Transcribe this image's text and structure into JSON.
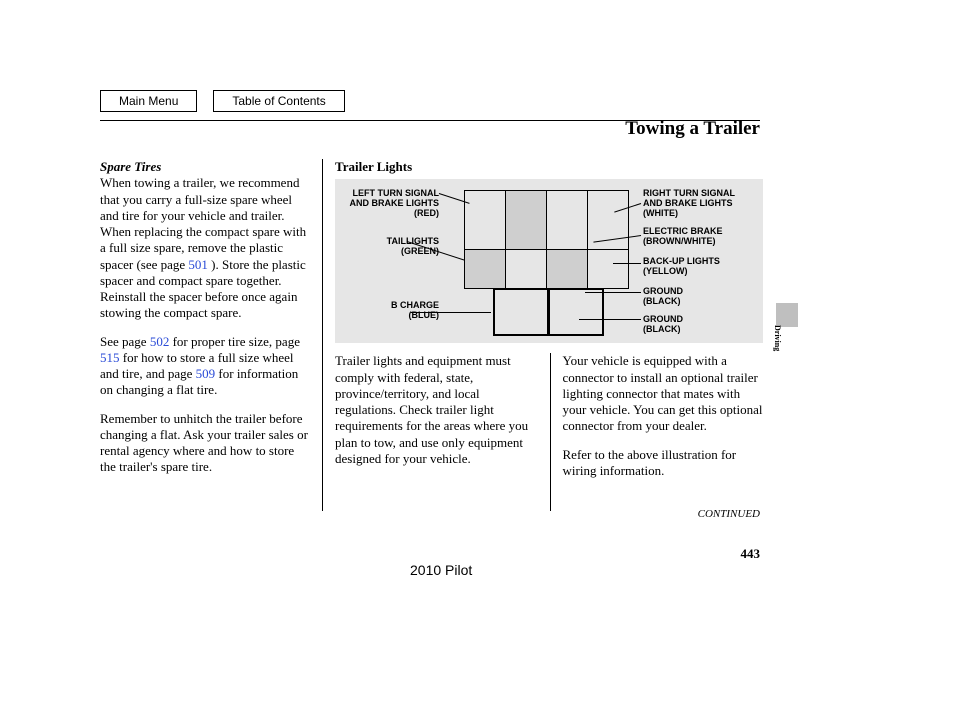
{
  "nav": {
    "main_menu": "Main Menu",
    "toc": "Table of Contents"
  },
  "title": "Towing a Trailer",
  "side_tab": "Driving",
  "spare_tires": {
    "heading": "Spare Tires",
    "p1a": "When towing a trailer, we recommend that you carry a full-size spare wheel and tire for your vehicle and trailer. When replacing the compact spare with a full size spare, remove the plastic spacer (see page ",
    "p1_link1": "501",
    "p1b": " ). Store the plastic spacer and compact spare together. Reinstall the spacer before once again stowing the compact spare.",
    "p2a": "See page ",
    "p2_link1": "502",
    "p2b": " for proper tire size, page ",
    "p2_link2": "515",
    "p2c": " for how to store a full size wheel and tire, and page ",
    "p2_link3": "509",
    "p2d": " for information on changing a flat tire.",
    "p3": "Remember to unhitch the trailer before changing a flat. Ask your trailer sales or rental agency where and how to store the trailer's spare tire."
  },
  "trailer_lights": {
    "heading": "Trailer Lights",
    "labels": {
      "left_turn": "LEFT TURN SIGNAL\nAND BRAKE LIGHTS\n(RED)",
      "taillights": "TAILLIGHTS\n(GREEN)",
      "b_charge": "B CHARGE\n(BLUE)",
      "right_turn": "RIGHT TURN SIGNAL\nAND BRAKE LIGHTS\n(WHITE)",
      "electric_brake": "ELECTRIC BRAKE\n(BROWN/WHITE)",
      "backup": "BACK-UP LIGHTS\n(YELLOW)",
      "ground1": "GROUND\n(BLACK)",
      "ground2": "GROUND\n(BLACK)"
    },
    "col_left": "Trailer lights and equipment must comply with federal, state, province/territory, and local regulations. Check trailer light requirements for the areas where you plan to tow, and use only equipment designed for your vehicle.",
    "col_right_p1": "Your vehicle is equipped with a connector to install an optional trailer lighting connector that mates with your vehicle. You can get this optional connector from your dealer.",
    "col_right_p2": "Refer to the above illustration for wiring information."
  },
  "continued": "CONTINUED",
  "page_number": "443",
  "vehicle": "2010 Pilot"
}
